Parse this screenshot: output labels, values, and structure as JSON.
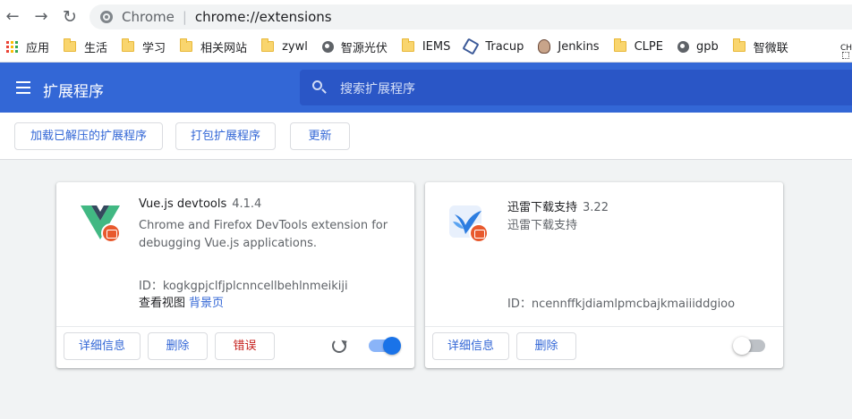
{
  "browser": {
    "address": {
      "site": "Chrome",
      "url": "chrome://extensions"
    },
    "bookmarks": [
      {
        "label": "应用",
        "icon": "apps-icon"
      },
      {
        "label": "生活",
        "icon": "folder-icon"
      },
      {
        "label": "学习",
        "icon": "folder-icon"
      },
      {
        "label": "相关网站",
        "icon": "folder-icon"
      },
      {
        "label": "zywl",
        "icon": "folder-icon"
      },
      {
        "label": "智源光伏",
        "icon": "globe-icon"
      },
      {
        "label": "IEMS",
        "icon": "folder-icon"
      },
      {
        "label": "Tracup",
        "icon": "tracup-icon"
      },
      {
        "label": "Jenkins",
        "icon": "jenkins-icon"
      },
      {
        "label": "CLPE",
        "icon": "folder-icon"
      },
      {
        "label": "gpb",
        "icon": "globe-icon"
      },
      {
        "label": "智微联",
        "icon": "folder-icon"
      }
    ],
    "overflow_text": "CH"
  },
  "header": {
    "title": "扩展程序",
    "search_placeholder": "搜索扩展程序"
  },
  "actions": {
    "load_unpacked": "加载已解压的扩展程序",
    "pack": "打包扩展程序",
    "update": "更新"
  },
  "colors": {
    "header_bg": "#3367d6",
    "search_bg": "#2a56c6",
    "link": "#3367d6",
    "error": "#c5221f",
    "toggle_on": "#1a73e8"
  },
  "extensions": [
    {
      "name": "Vue.js devtools",
      "version": "4.1.4",
      "description": "Chrome and Firefox DevTools extension for debugging Vue.js applications.",
      "id_label": "ID：",
      "id": "kogkgpjclfjplcnncellbehlnmeikiji",
      "views_label": "查看视图",
      "views_link": "背景页",
      "details": "详细信息",
      "remove": "删除",
      "errors": "错误",
      "enabled": true
    },
    {
      "name": "迅雷下载支持",
      "version": "3.22",
      "description": "迅雷下载支持",
      "id_label": "ID：",
      "id": "ncennffkjdiamlpmcbajkmaiiiddgioo",
      "details": "详细信息",
      "remove": "删除",
      "enabled": false
    }
  ]
}
